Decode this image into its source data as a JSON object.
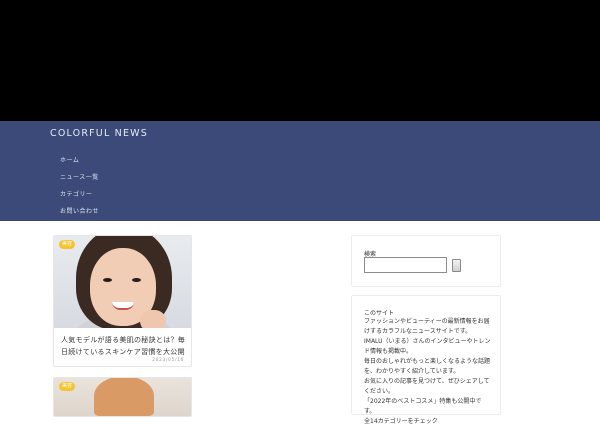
{
  "site": {
    "title": "COLORFUL NEWS"
  },
  "nav": {
    "items": [
      {
        "label": "ホーム"
      },
      {
        "label": "ニュース一覧"
      },
      {
        "label": "カテゴリー"
      },
      {
        "label": "お問い合わせ"
      }
    ]
  },
  "posts": [
    {
      "tag": "美容",
      "title": "人気モデルが語る美肌の秘訣とは？毎日続けているスキンケア習慣を大公開",
      "date": "2023/05/16"
    },
    {
      "tag": "美容"
    }
  ],
  "sidebar": {
    "search": {
      "title": "検索",
      "placeholder": "",
      "button_label": ""
    },
    "about": {
      "title": "このサイト",
      "text": "ファッションやビューティーの最新情報をお届けするカラフルなニュースサイトです。\nIMALU（いまる）さんのインタビューやトレンド情報も掲載中。\n毎日のおしゃれがもっと楽しくなるような話題を、わかりやすく紹介しています。\nお気に入りの記事を見つけて、ぜひシェアしてください。\n「2022年のベストコスメ」特集も公開中です。\n全14カテゴリーをチェック"
    }
  },
  "colors": {
    "header_bg": "#000000",
    "nav_bg": "#3b4a78",
    "tag": "#f4c431"
  }
}
